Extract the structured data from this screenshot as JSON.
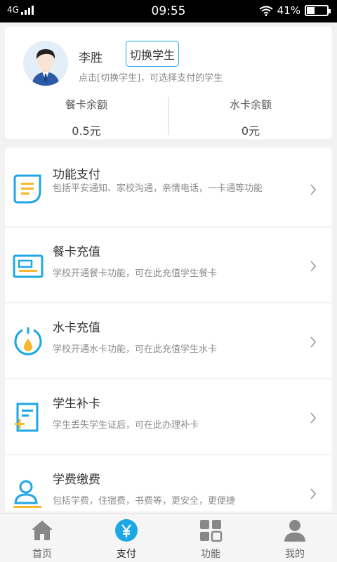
{
  "status_bar": {
    "network": "4G",
    "time": "09:55",
    "battery": "41%",
    "battery_level": 0.41
  },
  "profile": {
    "name": "李胜",
    "switch_label": "切换学生",
    "hint": "点击[切换学生]，可选择支付的学生",
    "meal_card": {
      "label": "餐卡余额",
      "value": "0.5元"
    },
    "water_card": {
      "label": "水卡余额",
      "value": "0元"
    }
  },
  "menu": {
    "items": [
      {
        "title": "功能支付",
        "desc": "包括平安通知、家校沟通，亲情电话，一卡通等功能",
        "icon": "document-icon"
      },
      {
        "title": "餐卡充值",
        "desc": "学校开通餐卡功能，可在此充值学生餐卡",
        "icon": "id-card-icon"
      },
      {
        "title": "水卡充值",
        "desc": "学校开通水卡功能，可在此充值学生水卡",
        "icon": "water-drop-icon"
      },
      {
        "title": "学生补卡",
        "desc": "学生丢失学生证后，可在此办理补卡",
        "icon": "reissue-card-icon"
      },
      {
        "title": "学费缴费",
        "desc": "包括学费，住宿费，书费等，更安全，更便捷",
        "icon": "user-icon"
      }
    ]
  },
  "tabbar": {
    "tabs": [
      {
        "label": "首页",
        "icon": "home-icon"
      },
      {
        "label": "支付",
        "icon": "yuan-icon"
      },
      {
        "label": "功能",
        "icon": "grid-icon"
      },
      {
        "label": "我的",
        "icon": "person-icon"
      }
    ],
    "active_index": 1
  },
  "colors": {
    "accent": "#1ea7e6",
    "icon_yellow": "#f5b82e"
  }
}
